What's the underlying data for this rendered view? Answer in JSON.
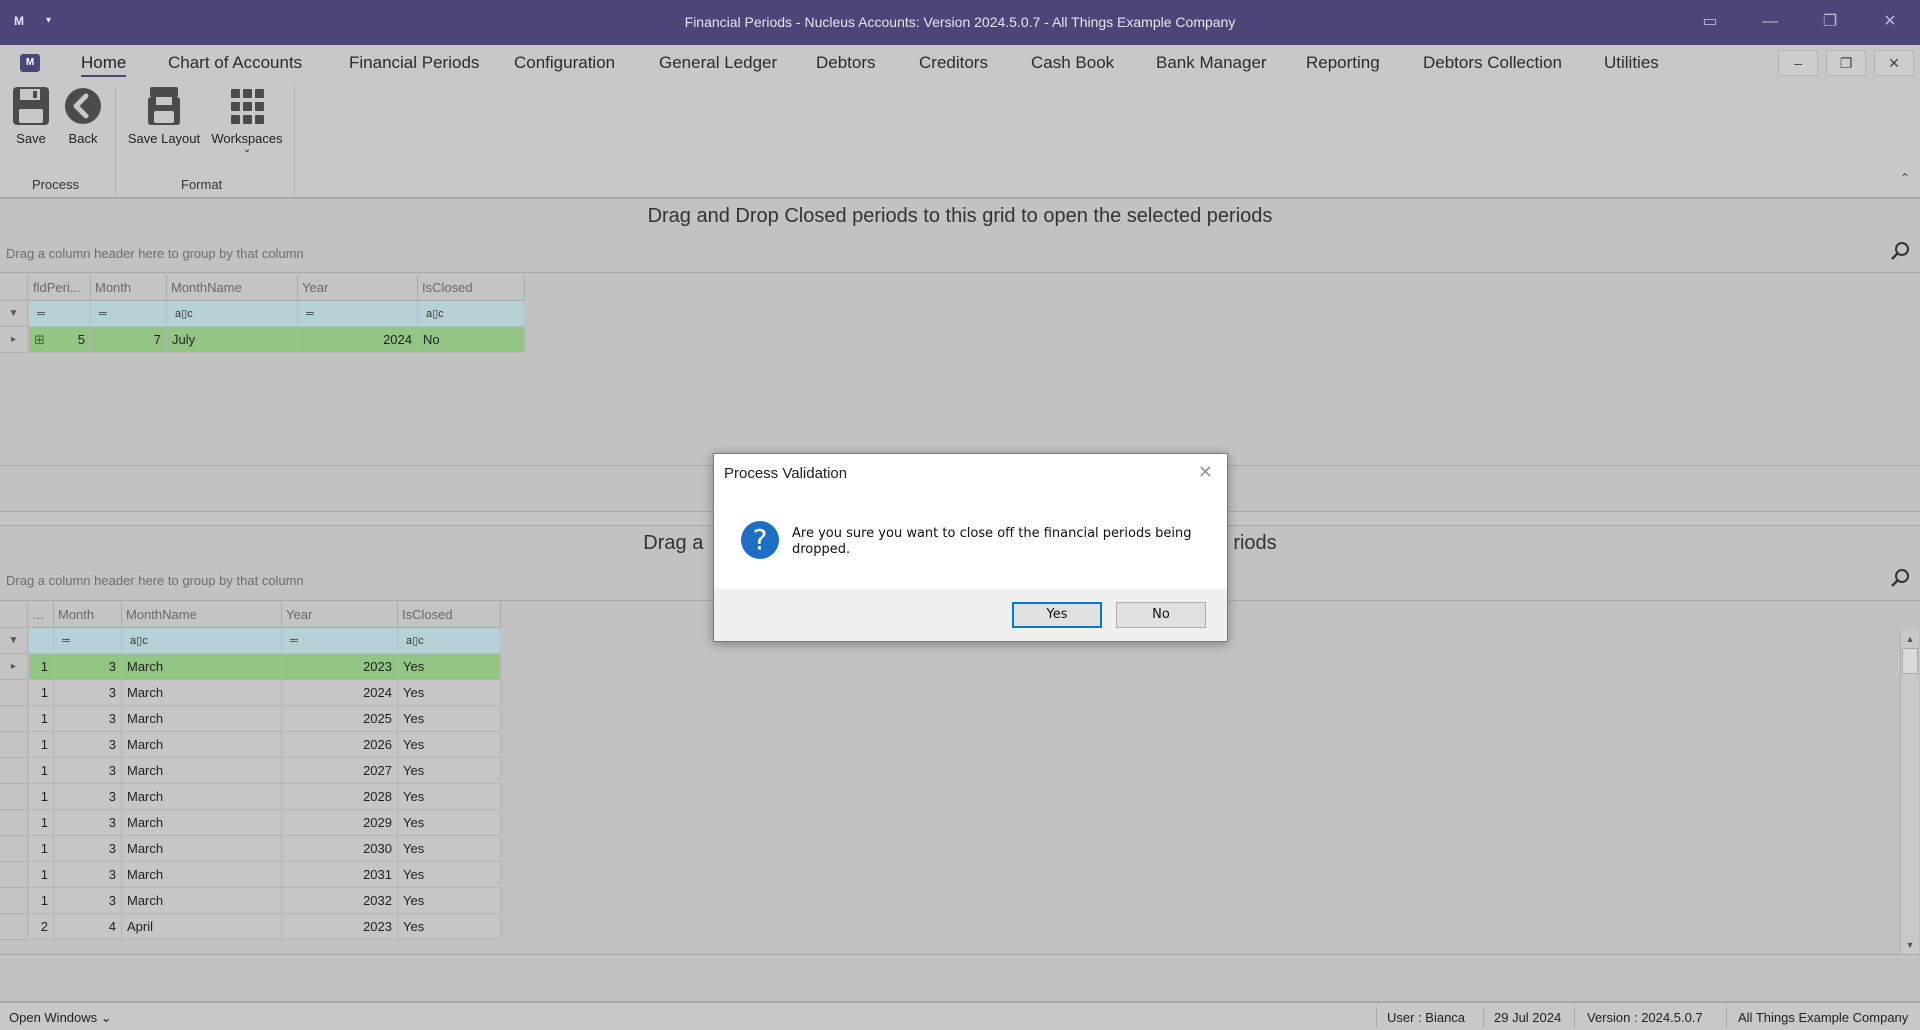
{
  "window": {
    "app_icon": "nucleus-logo-icon",
    "title": "Financial Periods - Nucleus Accounts: Version 2024.5.0.7 - All Things Example Company",
    "quick_access_caret": "▾"
  },
  "menu": {
    "items": [
      "Home",
      "Chart of Accounts",
      "Financial Periods",
      "Configuration",
      "General Ledger",
      "Debtors",
      "Creditors",
      "Cash Book",
      "Bank Manager",
      "Reporting",
      "Debtors Collection",
      "Utilities"
    ],
    "active": "Home"
  },
  "ribbon": {
    "save_label": "Save",
    "back_label": "Back",
    "save_layout_label": "Save Layout",
    "workspaces_label": "Workspaces",
    "group_process": "Process",
    "group_format": "Format"
  },
  "top_grid": {
    "title": "Drag and Drop Closed periods to this grid to open the selected periods",
    "group_hint": "Drag a column header here to group by that column",
    "columns": [
      "fldPeri...",
      "Month",
      "MonthName",
      "Year",
      "IsClosed"
    ],
    "rows": [
      {
        "fldPeriod": "5",
        "month": "7",
        "month_name": "July",
        "year": "2024",
        "is_closed": "No"
      }
    ]
  },
  "bottom_grid": {
    "title": "Drag and Drop Open periods to this grid to close the selected periods",
    "title_visible_left": "Drag a",
    "title_visible_right": "riods",
    "group_hint": "Drag a column header here to group by that column",
    "columns": [
      "...",
      "Month",
      "MonthName",
      "Year",
      "IsClosed"
    ],
    "rows": [
      {
        "period": "1",
        "month": "3",
        "month_name": "March",
        "year": "2023",
        "is_closed": "Yes"
      },
      {
        "period": "1",
        "month": "3",
        "month_name": "March",
        "year": "2024",
        "is_closed": "Yes"
      },
      {
        "period": "1",
        "month": "3",
        "month_name": "March",
        "year": "2025",
        "is_closed": "Yes"
      },
      {
        "period": "1",
        "month": "3",
        "month_name": "March",
        "year": "2026",
        "is_closed": "Yes"
      },
      {
        "period": "1",
        "month": "3",
        "month_name": "March",
        "year": "2027",
        "is_closed": "Yes"
      },
      {
        "period": "1",
        "month": "3",
        "month_name": "March",
        "year": "2028",
        "is_closed": "Yes"
      },
      {
        "period": "1",
        "month": "3",
        "month_name": "March",
        "year": "2029",
        "is_closed": "Yes"
      },
      {
        "period": "1",
        "month": "3",
        "month_name": "March",
        "year": "2030",
        "is_closed": "Yes"
      },
      {
        "period": "1",
        "month": "3",
        "month_name": "March",
        "year": "2031",
        "is_closed": "Yes"
      },
      {
        "period": "1",
        "month": "3",
        "month_name": "March",
        "year": "2032",
        "is_closed": "Yes"
      },
      {
        "period": "2",
        "month": "4",
        "month_name": "April",
        "year": "2023",
        "is_closed": "Yes"
      }
    ]
  },
  "dialog": {
    "title": "Process Validation",
    "message": "Are you sure you want to close off the financial periods being dropped.",
    "yes_label": "Yes",
    "no_label": "No",
    "icon": "question-icon"
  },
  "status": {
    "open_windows": "Open Windows",
    "user": "User : Bianca",
    "date": "29 Jul 2024",
    "version": "Version : 2024.5.0.7",
    "company": "All Things Example Company"
  },
  "colors": {
    "titlebar": "#4a4778",
    "selected_row": "#93c584",
    "filter_row": "#b6d2d7",
    "dialog_accent": "#0078d7"
  }
}
